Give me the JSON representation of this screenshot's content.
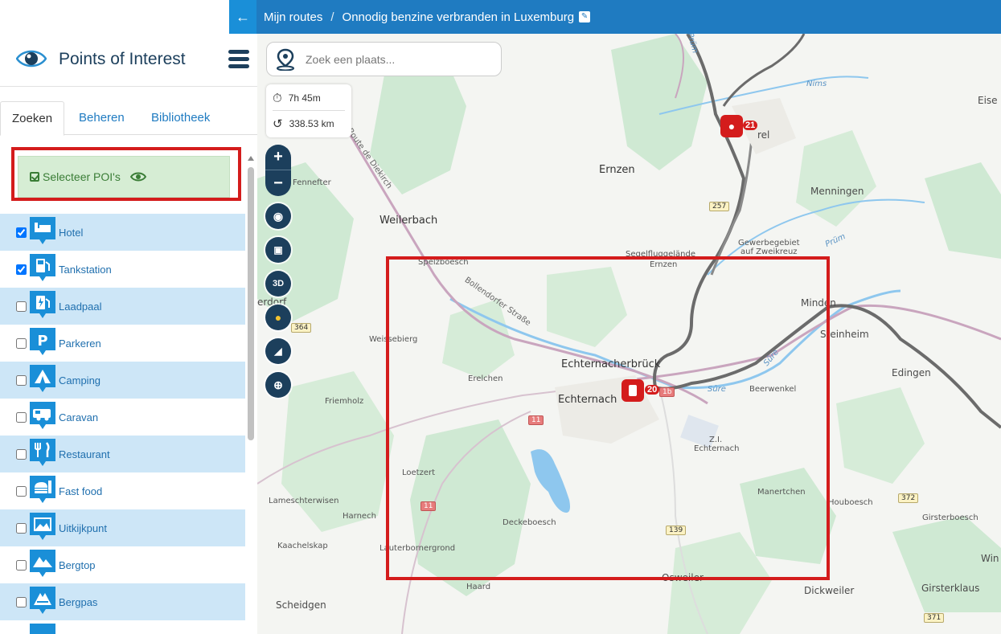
{
  "header": {
    "crumb_root": "Mijn routes",
    "crumb_sep": "/",
    "crumb_current": "Onnodig benzine verbranden in Luxemburg",
    "back_icon": "arrow-left-icon",
    "edit_icon": "pencil-icon"
  },
  "sidebar": {
    "title": "Points of Interest",
    "tabs": [
      "Zoeken",
      "Beheren",
      "Bibliotheek"
    ],
    "active_tab": "Zoeken",
    "select_label": "Selecteer POI's",
    "poi_items": [
      {
        "label": "Hotel",
        "checked": true,
        "icon": "hotel-icon"
      },
      {
        "label": "Tankstation",
        "checked": true,
        "icon": "fuel-icon"
      },
      {
        "label": "Laadpaal",
        "checked": false,
        "icon": "charging-icon"
      },
      {
        "label": "Parkeren",
        "checked": false,
        "icon": "parking-icon"
      },
      {
        "label": "Camping",
        "checked": false,
        "icon": "camping-icon"
      },
      {
        "label": "Caravan",
        "checked": false,
        "icon": "caravan-icon"
      },
      {
        "label": "Restaurant",
        "checked": false,
        "icon": "restaurant-icon"
      },
      {
        "label": "Fast food",
        "checked": false,
        "icon": "fastfood-icon"
      },
      {
        "label": "Uitkijkpunt",
        "checked": false,
        "icon": "viewpoint-icon"
      },
      {
        "label": "Bergtop",
        "checked": false,
        "icon": "mountain-icon"
      },
      {
        "label": "Bergpas",
        "checked": false,
        "icon": "pass-icon"
      }
    ]
  },
  "map": {
    "search_placeholder": "Zoek een plaats...",
    "duration": "7h 45m",
    "distance": "338.53 km",
    "zoom_in": "+",
    "zoom_out": "−",
    "btn_3d": "3D",
    "waypoint_20": "20",
    "waypoint_21": "21",
    "places": {
      "ernzen": "Ernzen",
      "ernzen_small": "Ernzen",
      "menningen": "Menningen",
      "weilerbach": "Weilerbach",
      "fennefter": "Fennefter",
      "spelzboesch": "Spelzboesch",
      "segelflug": "Segelfluggelände",
      "gewerbe": "Gewerbegebiet",
      "zweikreuz": "auf Zweikreuz",
      "minden": "Minden",
      "steinheim": "Steinheim",
      "edingen": "Edingen",
      "echternacherbruck": "Echternacherbrück",
      "echternach": "Echternach",
      "erelchen": "Erelchen",
      "friemholz": "Friemholz",
      "beerwenkel": "Beerwenkel",
      "zi": "Z.I.",
      "zi2": "Echternach",
      "loetzert": "Loetzert",
      "lameschterwisen": "Lameschterwisen",
      "harnech": "Harnech",
      "deckeboesch": "Deckeboesch",
      "manertchen": "Manertchen",
      "houboesch": "Houboesch",
      "girsterboesch": "Girsterboesch",
      "kaachelskap": "Kaachelskap",
      "lauterborn": "Lauterbornergrond",
      "haard": "Haard",
      "osweiler": "Osweiler",
      "dickweiler": "Dickweiler",
      "girsterklaus": "Girsterklaus",
      "scheidgen": "Scheidgen",
      "eisen": "Eise",
      "wi": "Win",
      "erdorf": "erdorf",
      "weissebierg": "Weissebierg",
      "nims": "Nims",
      "prum": "Prüm",
      "sure": "Sûre",
      "sure2": "Sûre",
      "bollendorfer": "Bollendorfer Straße",
      "diekirch": "Route de Diekirch",
      "fel": "rel",
      "rum": "Prüm"
    },
    "shields": {
      "s257": "257",
      "s364": "364",
      "s11a": "11",
      "s11b": "11",
      "s139": "139",
      "s372": "372",
      "s371": "371",
      "s1b": "1b"
    }
  }
}
